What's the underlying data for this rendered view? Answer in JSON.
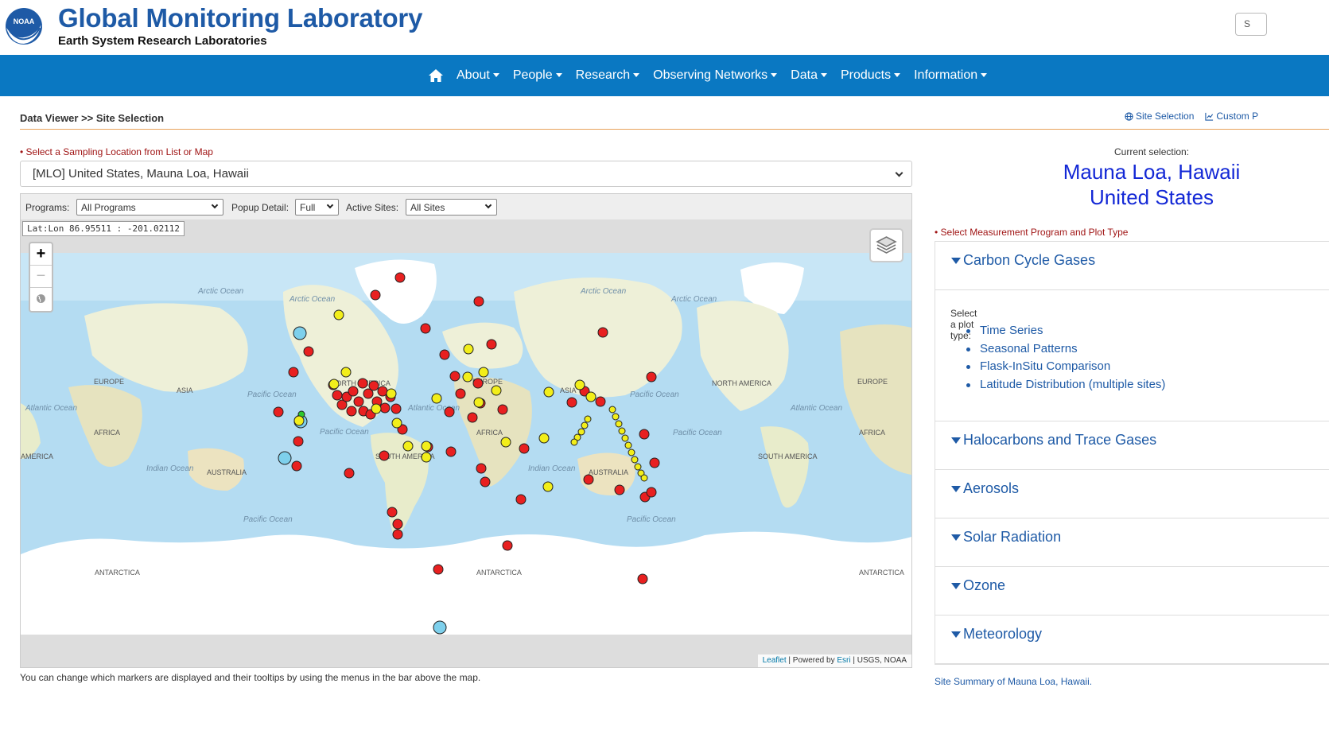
{
  "header": {
    "title": "Global Monitoring Laboratory",
    "subtitle": "Earth System Research Laboratories",
    "logo_text": "NOAA",
    "search_partial": "S"
  },
  "nav": {
    "home_icon": "home-icon",
    "items": [
      "About",
      "People",
      "Research",
      "Observing Networks",
      "Data",
      "Products",
      "Information"
    ]
  },
  "breadcrumb": "Data Viewer >> Site Selection",
  "top_links": [
    "Site Selection",
    "Custom P"
  ],
  "location": {
    "label": "• Select a Sampling Location from List or Map",
    "selected": "[MLO] United States, Mauna Loa, Hawaii"
  },
  "toolbar": {
    "programs_label": "Programs:",
    "programs_value": "All Programs",
    "popup_label": "Popup Detail:",
    "popup_value": "Full",
    "active_label": "Active Sites:",
    "active_value": "All Sites"
  },
  "latlon": "Lat:Lon 86.95511 : -201.02112",
  "zoom": {
    "in": "+",
    "out": "−"
  },
  "map_labels": {
    "oceans": [
      "Arctic Ocean",
      "Arctic Ocean",
      "Arctic Ocean",
      "Arctic Ocean",
      "Pacific Ocean",
      "Pacific Ocean",
      "Atlantic Ocean",
      "Atlantic Ocean",
      "Pacific Ocean",
      "Atlantic Ocean",
      "Indian Ocean",
      "Indian Ocean",
      "Pacific Ocean",
      "Pacific Ocean",
      "Pacific Ocean"
    ],
    "continents": [
      "EUROPE",
      "ASIA",
      "NORTH AMERICA",
      "EUROPE",
      "ASIA",
      "NORTH AMERICA",
      "EUROPE",
      "AFRICA",
      "SOUTH AMERICA",
      "AFRICA",
      "AMERICA",
      "AUSTRALIA",
      "AUSTRALIA",
      "SOUTH AMERICA",
      "AFRICA",
      "ANTARCTICA",
      "ANTARCTICA",
      "ANTARCTICA"
    ]
  },
  "attribution": {
    "leaflet": "Leaflet",
    "powered": " | Powered by ",
    "esri": "Esri",
    "rest": " | USGS, NOAA"
  },
  "map_note": "You can change which markers are displayed and their tooltips by using the menus in the bar above the map.",
  "current": {
    "label": "Current selection:",
    "line1": "Mauna Loa, Hawaii",
    "line2": "United States"
  },
  "measurement_label": "• Select Measurement Program and Plot Type",
  "programs": [
    {
      "title": "Carbon Cycle Gases",
      "expanded": true
    },
    {
      "title": "Halocarbons and Trace Gases",
      "expanded": false
    },
    {
      "title": "Aerosols",
      "expanded": false
    },
    {
      "title": "Solar Radiation",
      "expanded": false
    },
    {
      "title": "Ozone",
      "expanded": false
    },
    {
      "title": "Meteorology",
      "expanded": false
    }
  ],
  "plot_type_label": "Select a plot type:",
  "plot_types": [
    "Time Series",
    "Seasonal Patterns",
    "Flask-InSitu Comparison",
    "Latitude Distribution (multiple sites)"
  ],
  "site_summary": "Site Summary of Mauna Loa, Hawaii.",
  "colors": {
    "nav": "#0a78c2",
    "title": "#1e5aa6",
    "selection": "#1328d6",
    "required": "#a01515",
    "rule": "#e8a25a",
    "marker_red": "#e82020",
    "marker_yellow": "#f2ee1a",
    "marker_blue": "#7ed0ec",
    "marker_green": "#2dc82d"
  }
}
